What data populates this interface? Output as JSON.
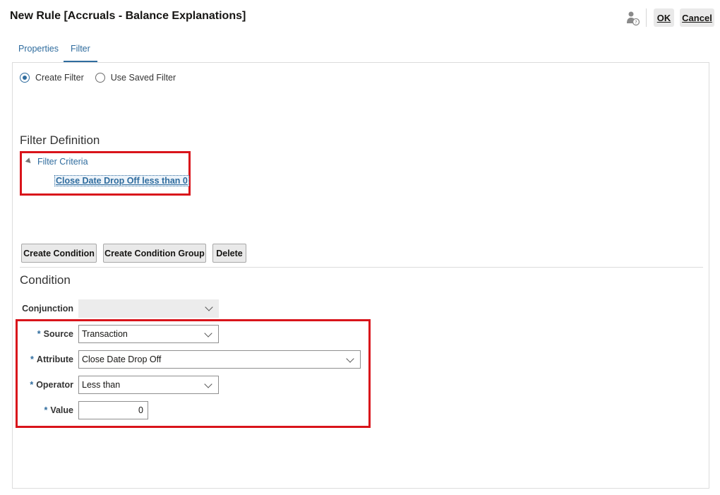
{
  "header": {
    "title": "New Rule [Accruals - Balance Explanations]",
    "ok_label": "OK",
    "cancel_label": "Cancel",
    "help_icon": "user-help-icon"
  },
  "tabs": [
    {
      "label": "Properties",
      "active": false
    },
    {
      "label": "Filter",
      "active": true
    }
  ],
  "filter_mode": {
    "options": [
      {
        "label": "Create Filter",
        "selected": true
      },
      {
        "label": "Use Saved Filter",
        "selected": false
      }
    ]
  },
  "filter_definition": {
    "heading": "Filter Definition",
    "tree_root": "Filter Criteria",
    "criteria": "Close Date Drop Off less than 0"
  },
  "actions": {
    "create_condition": "Create Condition",
    "create_condition_group": "Create Condition Group",
    "delete": "Delete"
  },
  "condition": {
    "heading": "Condition",
    "required_marker": "*",
    "conjunction": {
      "label": "Conjunction",
      "value": ""
    },
    "source": {
      "label": "Source",
      "value": "Transaction"
    },
    "attribute": {
      "label": "Attribute",
      "value": "Close Date Drop Off"
    },
    "operator": {
      "label": "Operator",
      "value": "Less than"
    },
    "value": {
      "label": "Value",
      "value": "0"
    }
  },
  "colors": {
    "accent": "#2f6c9e",
    "highlight_border": "#d9141b"
  }
}
